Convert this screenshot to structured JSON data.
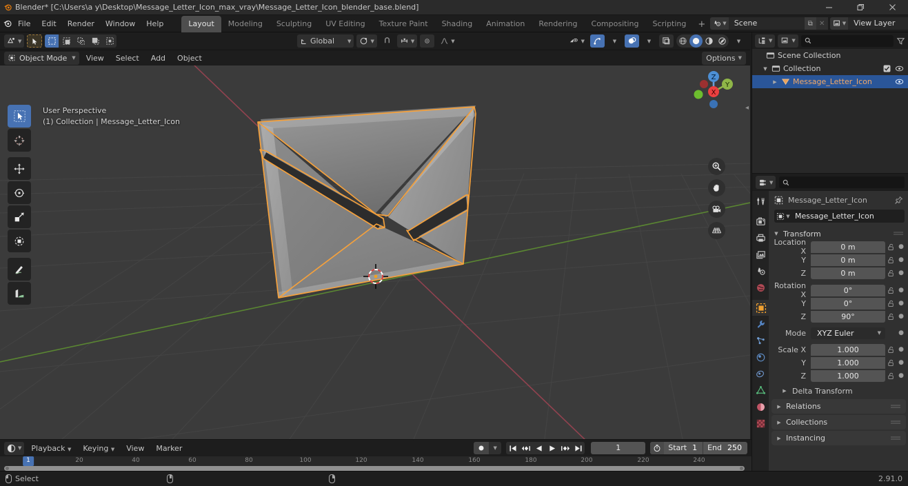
{
  "window": {
    "title": "Blender* [C:\\Users\\a y\\Desktop\\Message_Letter_Icon_max_vray\\Message_Letter_Icon_blender_base.blend]",
    "minimize_label": "–",
    "maximize_label": "❐",
    "close_label": "✕"
  },
  "menus": [
    "File",
    "Edit",
    "Render",
    "Window",
    "Help"
  ],
  "workspace_tabs": [
    {
      "label": "Layout",
      "active": true
    },
    {
      "label": "Modeling",
      "active": false
    },
    {
      "label": "Sculpting",
      "active": false
    },
    {
      "label": "UV Editing",
      "active": false
    },
    {
      "label": "Texture Paint",
      "active": false
    },
    {
      "label": "Shading",
      "active": false
    },
    {
      "label": "Animation",
      "active": false
    },
    {
      "label": "Rendering",
      "active": false
    },
    {
      "label": "Compositing",
      "active": false
    },
    {
      "label": "Scripting",
      "active": false
    }
  ],
  "workspace_add": "+",
  "topbar_right": {
    "scene_label": "Scene",
    "scene_new": "⧉",
    "scene_unlink": "✕",
    "viewlayer_label": "View Layer",
    "viewlayer_new": "⧉",
    "viewlayer_remove": "✕"
  },
  "viewport": {
    "mode": "Object Mode",
    "menus": [
      "View",
      "Select",
      "Add",
      "Object"
    ],
    "transform_orientation": "Global",
    "options_label": "Options",
    "overlay_line1": "User Perspective",
    "overlay_line2": "(1) Collection | Message_Letter_Icon",
    "gizmo_axes": [
      "X",
      "Y",
      "Z"
    ],
    "tools": [
      "tweak-select-tool",
      "cursor-tool",
      "move-tool",
      "rotate-tool",
      "scale-tool",
      "transform-tool",
      "annotate-tool",
      "measure-tool"
    ],
    "nav_buttons": [
      "zoom-icon",
      "pan-hand-icon",
      "camera-icon",
      "ortho-grid-icon"
    ],
    "colors": {
      "background": "#3b3b3b",
      "grid": "#4a4a4a",
      "axis_x": "#9c4c5a",
      "axis_y": "#6a9c40",
      "object_outline": "#f5a13c",
      "object_fill": "#8e8e8e"
    }
  },
  "outliner": {
    "search_placeholder": "",
    "rows": [
      {
        "name": "Scene Collection",
        "indent": 0,
        "icon": "collection-icon",
        "selected": false,
        "expander": "",
        "checkbox": false,
        "eye": false
      },
      {
        "name": "Collection",
        "indent": 1,
        "icon": "collection-icon",
        "selected": false,
        "expander": "▼",
        "checkbox": true,
        "eye": true
      },
      {
        "name": "Message_Letter_Icon",
        "indent": 2,
        "icon": "mesh-object-icon",
        "selected": true,
        "expander": "▶",
        "checkbox": false,
        "eye": true
      }
    ]
  },
  "properties": {
    "search_placeholder": "",
    "breadcrumb": "Message_Letter_Icon",
    "object_name": "Message_Letter_Icon",
    "tabs": [
      "tool-icon",
      "render-icon",
      "output-icon",
      "view-layer-icon",
      "scene-icon",
      "world-icon",
      "object-icon",
      "modifier-icon",
      "particles-icon",
      "physics-icon",
      "constraints-icon",
      "object-data-icon",
      "material-icon",
      "texture-icon"
    ],
    "active_tab": "object-icon",
    "transform": {
      "title": "Transform",
      "location": {
        "label": "Location X",
        "labels": [
          "Location X",
          "Y",
          "Z"
        ],
        "values": [
          "0 m",
          "0 m",
          "0 m"
        ]
      },
      "rotation": {
        "labels": [
          "Rotation X",
          "Y",
          "Z"
        ],
        "values": [
          "0°",
          "0°",
          "90°"
        ]
      },
      "mode": {
        "label": "Mode",
        "value": "XYZ Euler"
      },
      "scale": {
        "labels": [
          "Scale X",
          "Y",
          "Z"
        ],
        "values": [
          "1.000",
          "1.000",
          "1.000"
        ]
      },
      "delta": "Delta Transform"
    },
    "panels": [
      "Relations",
      "Collections",
      "Instancing"
    ]
  },
  "timeline": {
    "editor_menus": [
      "Playback",
      "Keying",
      "View",
      "Marker"
    ],
    "playback_buttons": [
      "jump-start-icon",
      "prev-keyframe-icon",
      "play-reverse-icon",
      "play-icon",
      "next-keyframe-icon",
      "jump-end-icon"
    ],
    "current_frame": "1",
    "start_label": "Start",
    "start_value": "1",
    "end_label": "End",
    "end_value": "250",
    "ruler_ticks": [
      "20",
      "40",
      "60",
      "80",
      "100",
      "120",
      "140",
      "160",
      "180",
      "200",
      "220",
      "240"
    ],
    "playhead_label": "1"
  },
  "statusbar": {
    "select_label": "Select",
    "version": "2.91.0"
  }
}
